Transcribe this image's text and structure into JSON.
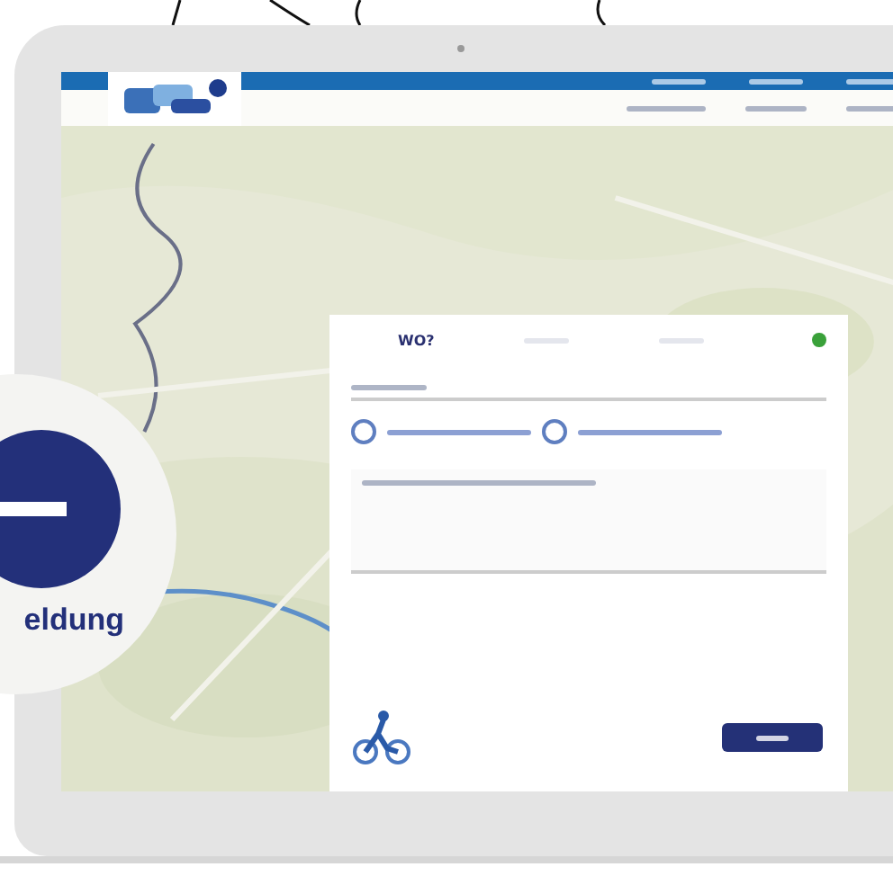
{
  "form": {
    "tabs": [
      {
        "label": "WO?",
        "selected": true
      }
    ]
  },
  "overlay": {
    "label": "eldung"
  }
}
